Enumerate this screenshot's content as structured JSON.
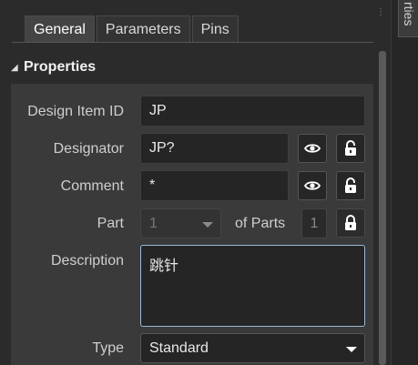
{
  "tabs": [
    {
      "label": "General",
      "active": true
    },
    {
      "label": "Parameters",
      "active": false
    },
    {
      "label": "Pins",
      "active": false
    }
  ],
  "section": {
    "title": "Properties"
  },
  "fields": {
    "design_item_id": {
      "label": "Design Item ID",
      "value": "JP"
    },
    "designator": {
      "label": "Designator",
      "value": "JP?"
    },
    "comment": {
      "label": "Comment",
      "value": "*"
    },
    "part": {
      "label": "Part",
      "value": "1",
      "of_parts_label": "of Parts",
      "of_parts_value": "1"
    },
    "description": {
      "label": "Description",
      "value": "跳针"
    },
    "type": {
      "label": "Type",
      "value": "Standard"
    }
  },
  "side_panel": {
    "tab_label": "rties"
  },
  "colors": {
    "background": "#2b2b2b",
    "panel": "#3a3a3a",
    "focus_border": "#9ab8d6"
  }
}
